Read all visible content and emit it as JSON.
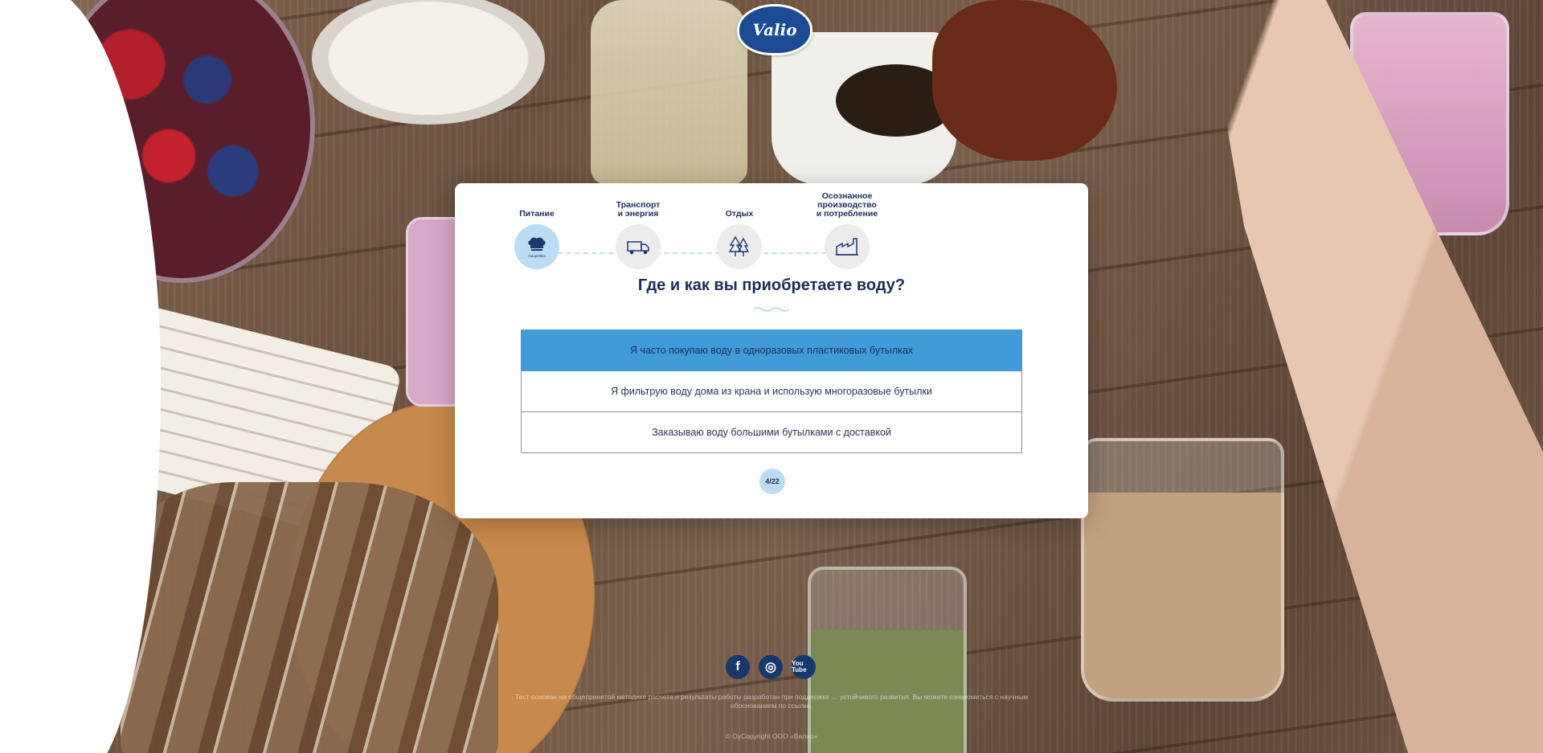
{
  "brand": {
    "logo_text": "Valio"
  },
  "steps": [
    {
      "label": "Питание",
      "icon": "chef-hat-icon",
      "active": true,
      "badge": "mauplökka"
    },
    {
      "label": "Транспорт\nи энергия",
      "icon": "truck-icon",
      "active": false
    },
    {
      "label": "Отдых",
      "icon": "trees-icon",
      "active": false
    },
    {
      "label": "Осознанное производство\nи потребление",
      "icon": "factory-icon",
      "active": false
    }
  ],
  "question": "Где и как вы приобретаете воду?",
  "answers": [
    {
      "label": "Я часто покупаю воду в одноразовых пластиковых бутылках",
      "selected": true
    },
    {
      "label": "Я фильтрую воду дома из крана и использую многоразовые бутылки",
      "selected": false
    },
    {
      "label": "Заказываю воду большими бутылками с доставкой",
      "selected": false
    }
  ],
  "progress": "4/22",
  "social": [
    {
      "name": "facebook",
      "glyph": "f"
    },
    {
      "name": "instagram",
      "glyph": "◎"
    },
    {
      "name": "youtube",
      "glyph": "You Tube"
    }
  ],
  "footer": {
    "disclaimer": "Тест основан на общепринятой методике расчета и результаты работы разработан при поддержке … устойчивого развития. Вы можете ознакомиться с научным обоснованием по ссылке.",
    "copyright": "© OyCopyright ООО «Валио»"
  },
  "colors": {
    "accent": "#409bd8",
    "navy": "#1d2d58",
    "active_step": "#bcdcf5"
  }
}
